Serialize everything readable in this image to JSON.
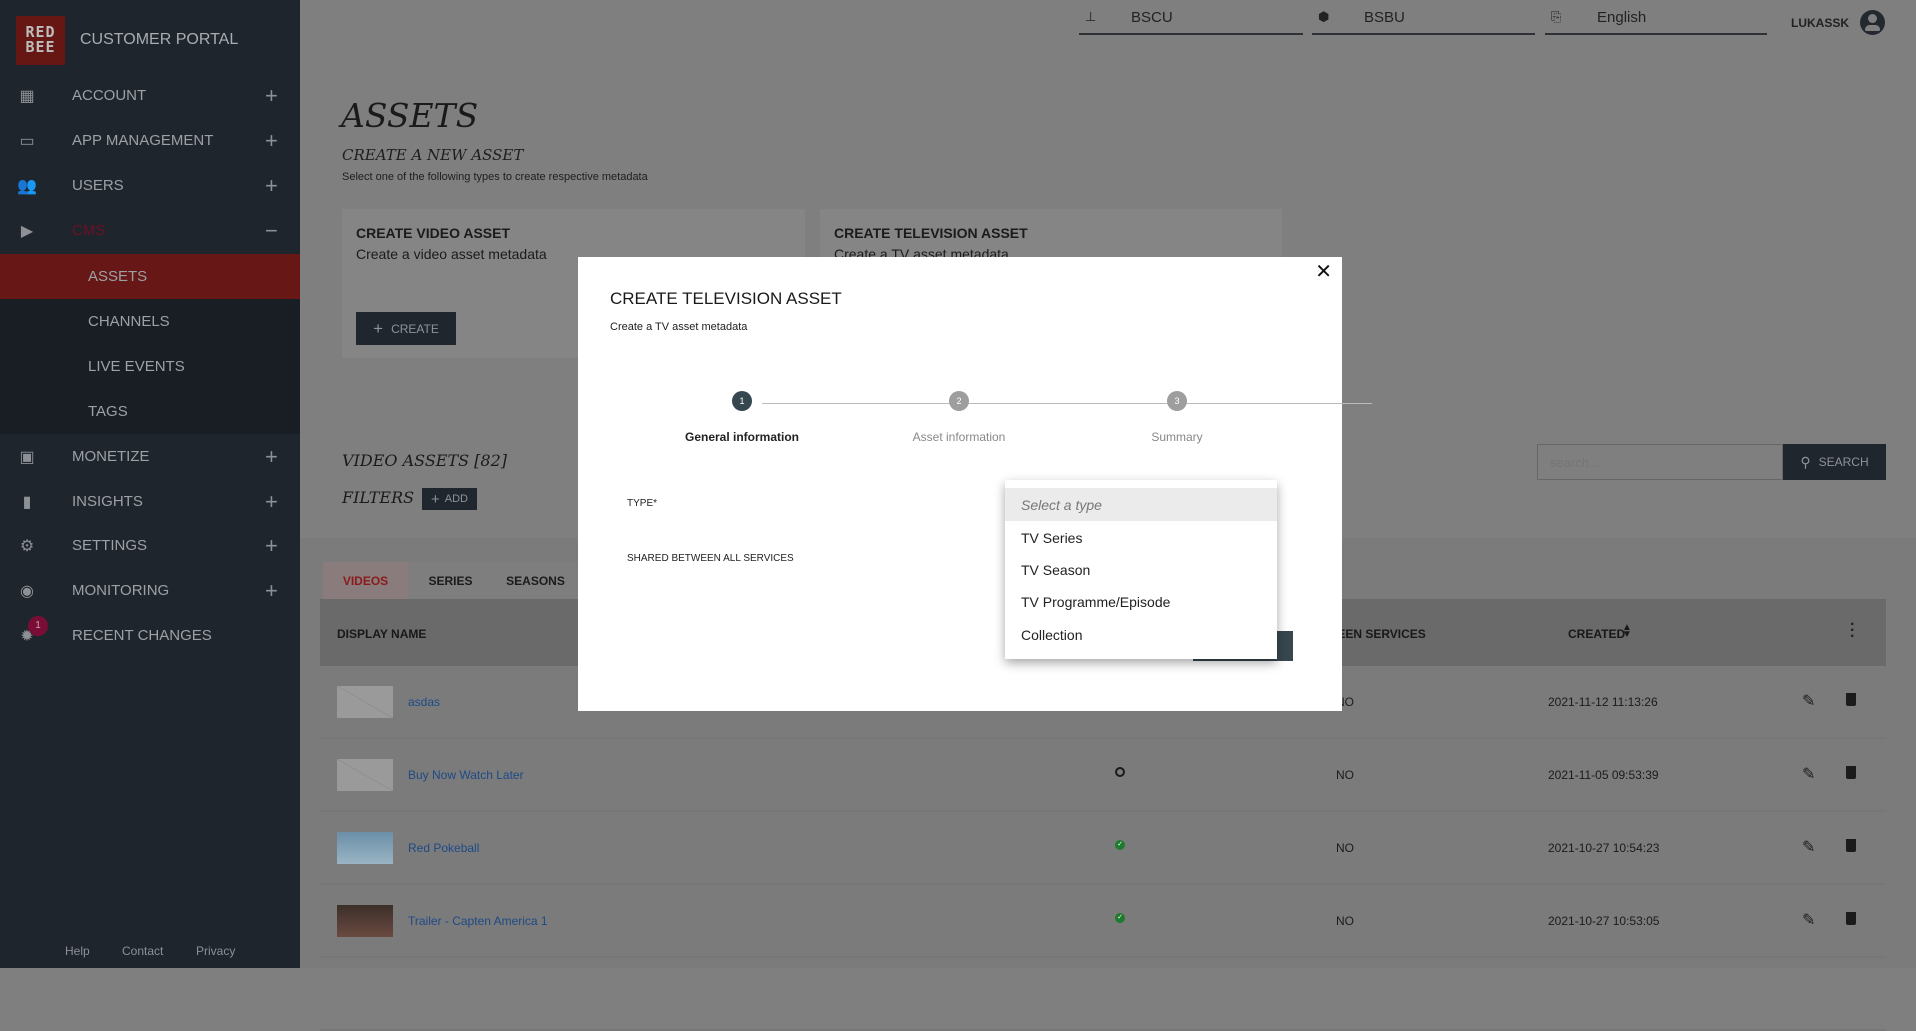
{
  "app": {
    "logo_text": "RED BEE",
    "title": "CUSTOMER PORTAL"
  },
  "sidebar": {
    "items": [
      {
        "label": "ACCOUNT",
        "icon": "building-icon",
        "expand": "+"
      },
      {
        "label": "APP MANAGEMENT",
        "icon": "devices-icon",
        "expand": "+"
      },
      {
        "label": "USERS",
        "icon": "users-icon",
        "expand": "+"
      },
      {
        "label": "CMS",
        "icon": "tv-play-icon",
        "expand": "−"
      },
      {
        "label": "MONETIZE",
        "icon": "money-icon",
        "expand": "+"
      },
      {
        "label": "INSIGHTS",
        "icon": "bar-chart-icon",
        "expand": "+"
      },
      {
        "label": "SETTINGS",
        "icon": "gear-icon",
        "expand": "+"
      },
      {
        "label": "MONITORING",
        "icon": "eye-icon",
        "expand": "+"
      },
      {
        "label": "RECENT CHANGES",
        "icon": "alert-gear-icon",
        "badge": "1"
      }
    ],
    "cms_sub": [
      "ASSETS",
      "CHANNELS",
      "LIVE EVENTS",
      "TAGS"
    ],
    "footer": [
      "Help",
      "Contact",
      "Privacy"
    ]
  },
  "topbar": {
    "customer": "BSCU",
    "business_unit": "BSBU",
    "language": "English",
    "user": "LUKASSK"
  },
  "page": {
    "title": "ASSETS",
    "subtitle": "CREATE A NEW ASSET",
    "hint": "Select one of the following types to create respective metadata",
    "cards": [
      {
        "title": "CREATE VIDEO ASSET",
        "desc": "Create a video asset metadata",
        "button": "CREATE"
      },
      {
        "title": "CREATE TELEVISION ASSET",
        "desc": "Create a TV asset metadata"
      }
    ],
    "list_title": "VIDEO ASSETS [82]",
    "filters_label": "FILTERS",
    "add_label": "ADD",
    "search_placeholder": "search...",
    "search_button": "SEARCH",
    "tabs": [
      "VIDEOS",
      "SERIES",
      "SEASONS"
    ],
    "columns": {
      "name": "DISPLAY NAME",
      "shared": "BETWEEN SERVICES",
      "created": "CREATED"
    },
    "rows": [
      {
        "name": "asdas",
        "status": null,
        "shared": "NO",
        "created": "2021-11-12 11:13:26",
        "thumb": "placeholder"
      },
      {
        "name": "Buy Now Watch Later",
        "status": "unpublished",
        "shared": "NO",
        "created": "2021-11-05 09:53:39",
        "thumb": "placeholder"
      },
      {
        "name": "Red Pokeball",
        "status": "published",
        "shared": "NO",
        "created": "2021-10-27 10:54:23",
        "thumb": "image"
      },
      {
        "name": "Trailer - Capten America 1",
        "status": "published",
        "shared": "NO",
        "created": "2021-10-27 10:53:05",
        "thumb": "image"
      }
    ]
  },
  "modal": {
    "title": "CREATE TELEVISION ASSET",
    "subtitle": "Create a TV asset metadata",
    "steps": [
      {
        "n": "1",
        "label": "General information",
        "active": true
      },
      {
        "n": "2",
        "label": "Asset information"
      },
      {
        "n": "3",
        "label": "Summary"
      }
    ],
    "type_label": "TYPE*",
    "shared_label": "SHARED BETWEEN ALL SERVICES",
    "dropdown": {
      "placeholder": "Select a type",
      "options": [
        "TV Series",
        "TV Season",
        "TV Programme/Episode",
        "Collection"
      ]
    }
  },
  "colors": {
    "sidebar": "#1f252d",
    "active": "#661716",
    "accent": "#c8102e",
    "dark_button": "#1f262d",
    "step_active": "#37474f",
    "step_inactive": "#9e9e9e"
  }
}
